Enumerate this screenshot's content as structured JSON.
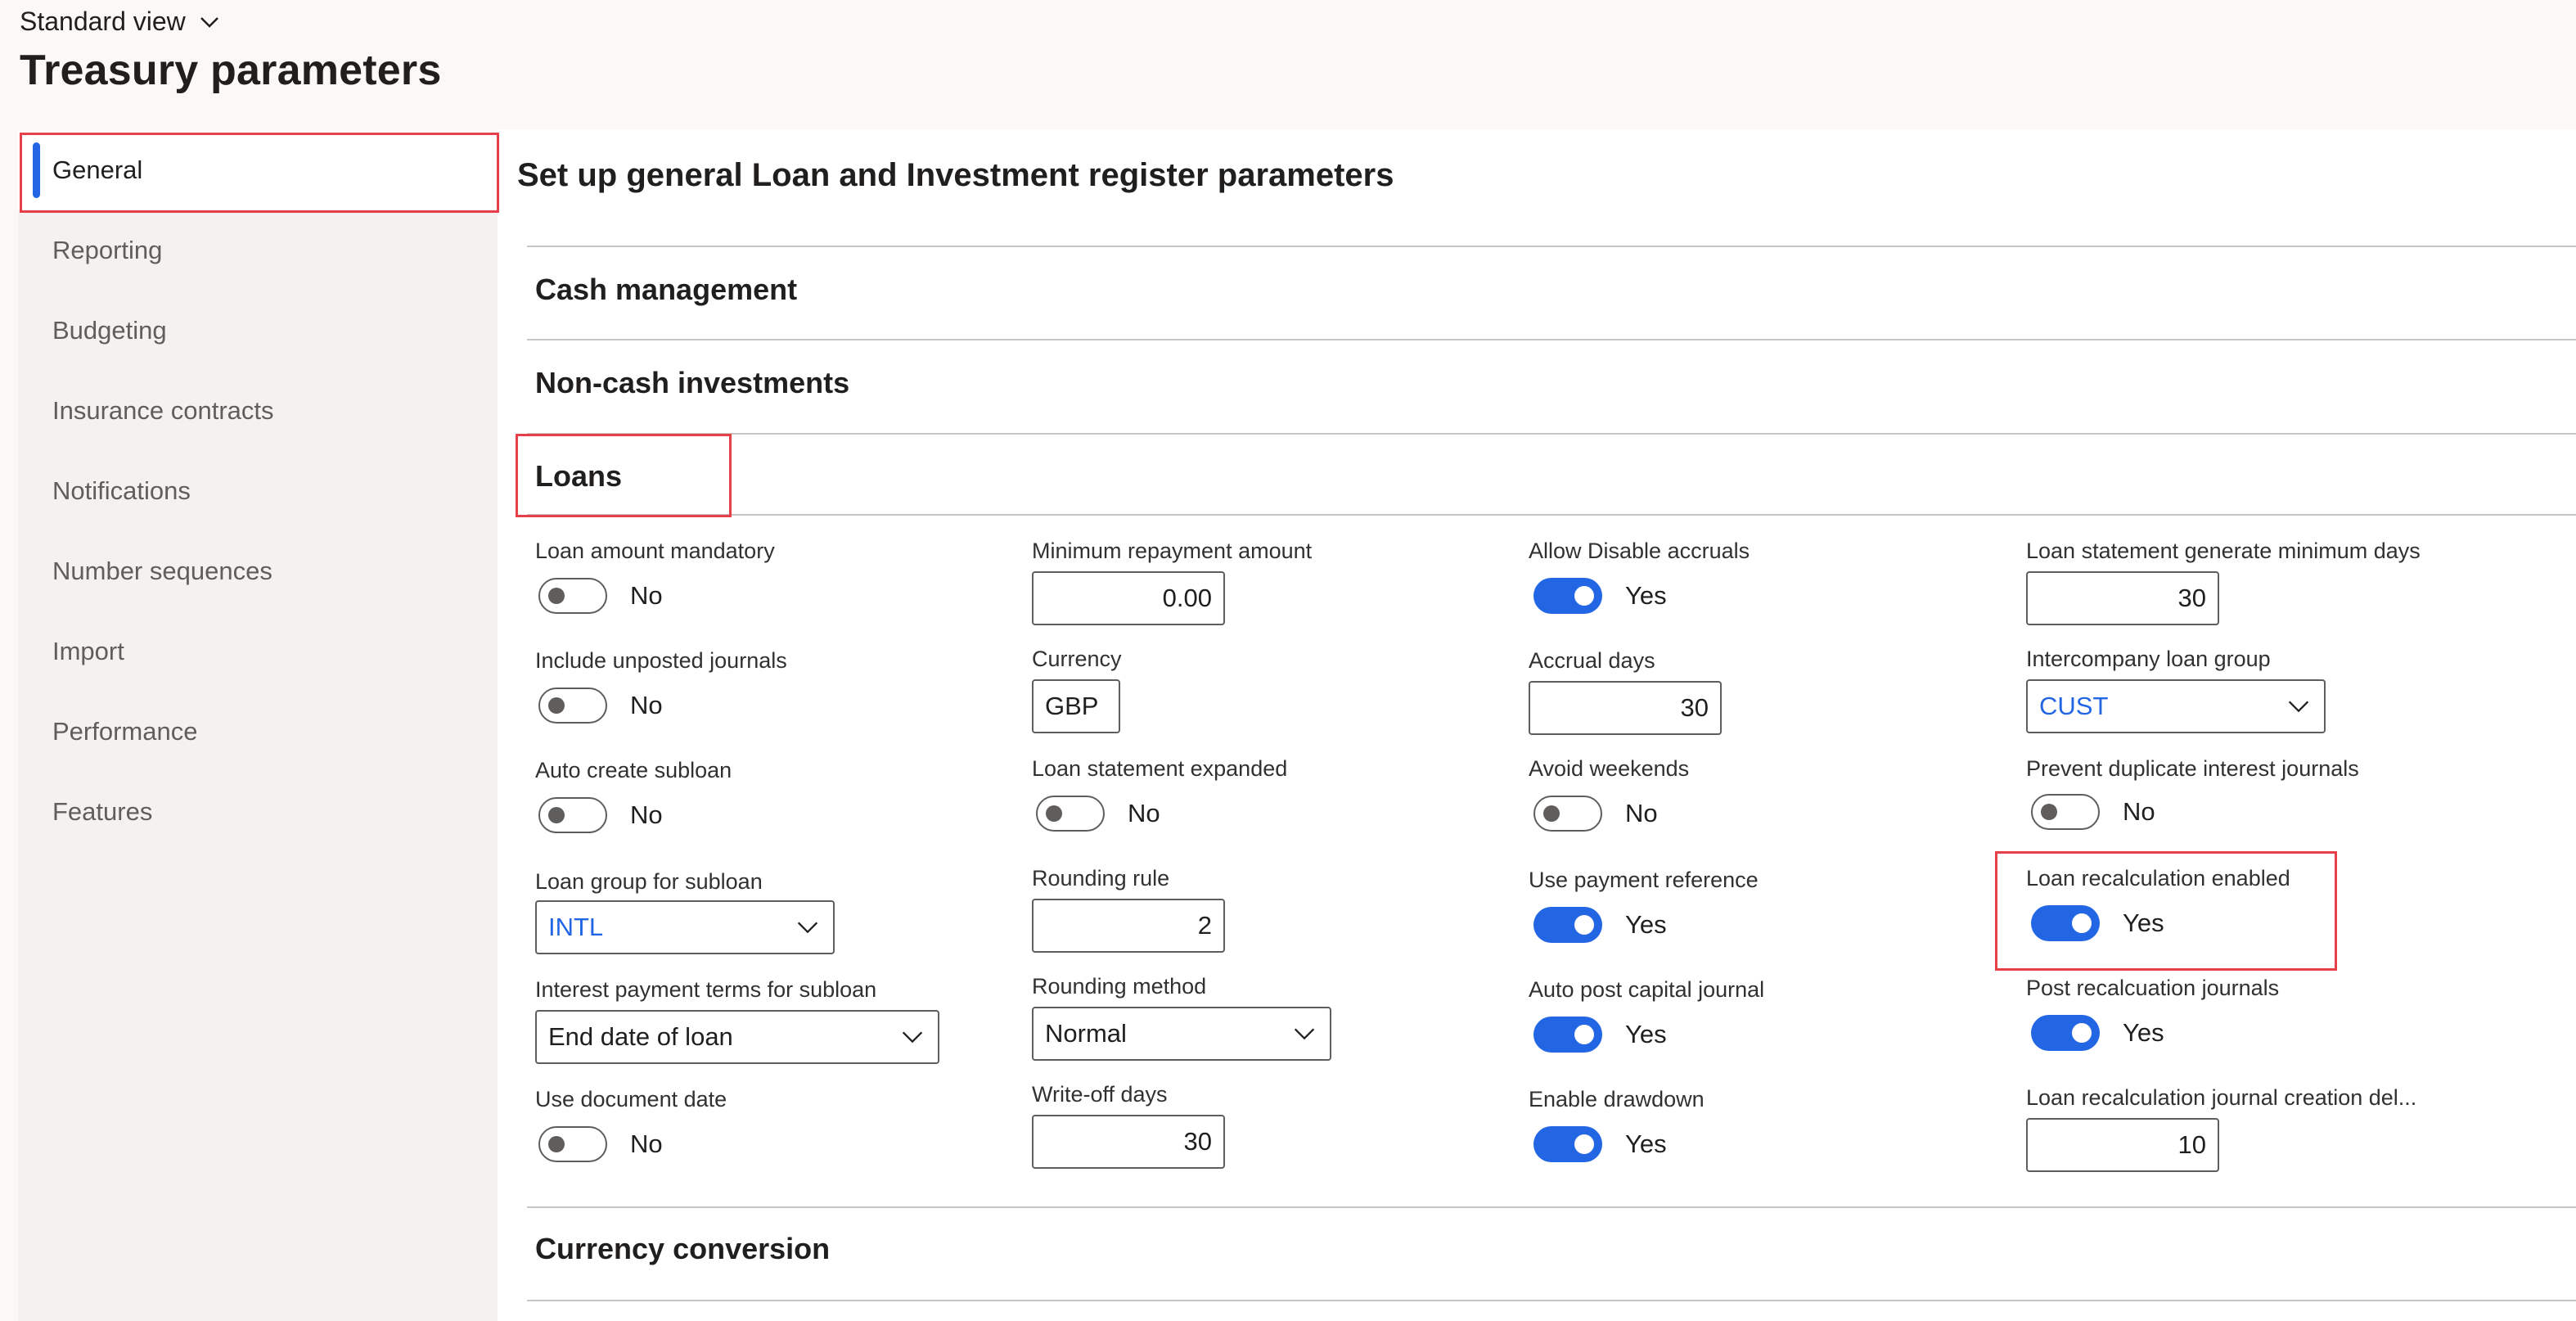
{
  "header": {
    "view_label": "Standard view",
    "page_title": "Treasury parameters"
  },
  "sidebar": {
    "items": [
      {
        "label": "General",
        "selected": true
      },
      {
        "label": "Reporting"
      },
      {
        "label": "Budgeting"
      },
      {
        "label": "Insurance contracts"
      },
      {
        "label": "Notifications"
      },
      {
        "label": "Number sequences"
      },
      {
        "label": "Import"
      },
      {
        "label": "Performance"
      },
      {
        "label": "Features"
      }
    ]
  },
  "main": {
    "heading": "Set up general Loan and Investment register parameters",
    "tabs": {
      "cash_management": "Cash management",
      "non_cash_investments": "Non-cash investments",
      "loans": "Loans",
      "currency_conversion": "Currency conversion"
    }
  },
  "loans": {
    "loan_amount_mandatory": {
      "label": "Loan amount mandatory",
      "value": "No"
    },
    "include_unposted_journals": {
      "label": "Include unposted journals",
      "value": "No"
    },
    "auto_create_subloan": {
      "label": "Auto create subloan",
      "value": "No"
    },
    "loan_group_for_subloan": {
      "label": "Loan group for subloan",
      "value": "INTL"
    },
    "interest_payment_terms_for_subloan": {
      "label": "Interest payment terms for subloan",
      "value": "End date of loan"
    },
    "use_document_date": {
      "label": "Use document date",
      "value": "No"
    },
    "minimum_repayment_amount": {
      "label": "Minimum repayment amount",
      "value": "0.00"
    },
    "currency": {
      "label": "Currency",
      "value": "GBP"
    },
    "loan_statement_expanded": {
      "label": "Loan statement expanded",
      "value": "No"
    },
    "rounding_rule": {
      "label": "Rounding rule",
      "value": "2"
    },
    "rounding_method": {
      "label": "Rounding method",
      "value": "Normal"
    },
    "write_off_days": {
      "label": "Write-off days",
      "value": "30"
    },
    "allow_disable_accruals": {
      "label": "Allow Disable accruals",
      "value": "Yes"
    },
    "accrual_days": {
      "label": "Accrual days",
      "value": "30"
    },
    "avoid_weekends": {
      "label": "Avoid weekends",
      "value": "No"
    },
    "use_payment_reference": {
      "label": "Use payment reference",
      "value": "Yes"
    },
    "auto_post_capital_journal": {
      "label": "Auto post capital journal",
      "value": "Yes"
    },
    "enable_drawdown": {
      "label": "Enable drawdown",
      "value": "Yes"
    },
    "loan_statement_generate_minimum_days": {
      "label": "Loan statement generate minimum days",
      "value": "30"
    },
    "intercompany_loan_group": {
      "label": "Intercompany loan group",
      "value": "CUST"
    },
    "prevent_duplicate_interest_journals": {
      "label": "Prevent duplicate interest journals",
      "value": "No"
    },
    "loan_recalculation_enabled": {
      "label": "Loan recalculation enabled",
      "value": "Yes"
    },
    "post_recalculation_journals": {
      "label": "Post recalcuation journals",
      "value": "Yes"
    },
    "loan_recalculation_journal_creation_delay": {
      "label": "Loan recalculation journal creation del...",
      "value": "10"
    }
  },
  "colors": {
    "accent": "#2266e3",
    "highlight": "#e8404b"
  }
}
